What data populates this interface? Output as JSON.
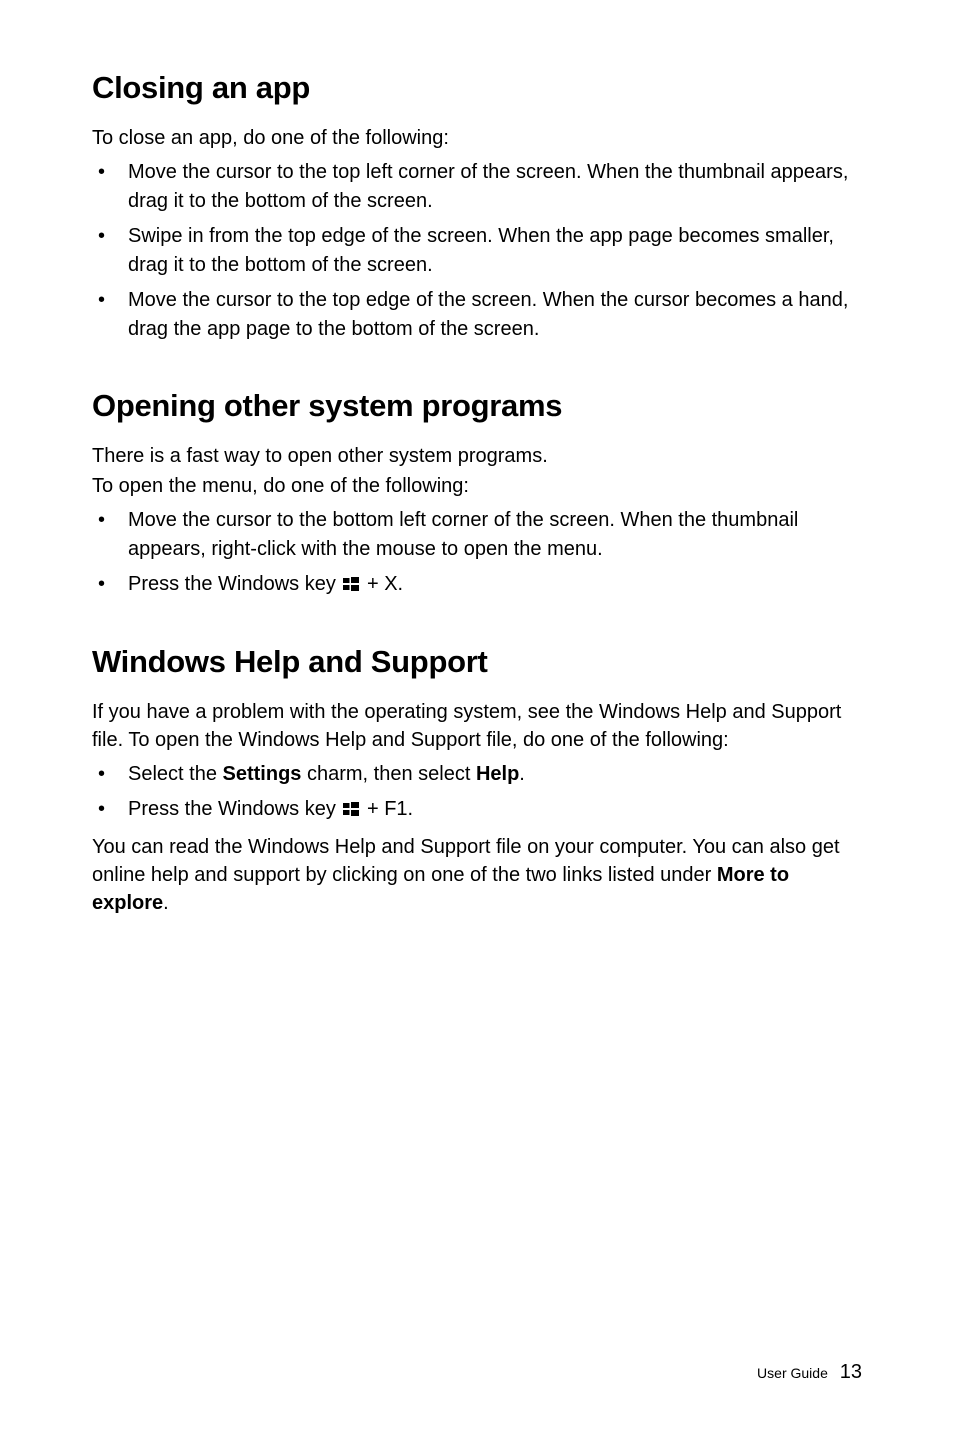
{
  "sections": {
    "closing": {
      "heading": "Closing an app",
      "intro": "To close an app, do one of the following:",
      "bullets": [
        "Move the cursor to the top left corner of the screen. When the thumbnail appears, drag it to the bottom of the screen.",
        "Swipe in from the top edge of the screen. When the app page becomes smaller, drag it to the bottom of the screen.",
        "Move the cursor to the top edge of the screen. When the cursor becomes a hand, drag the app page to the bottom of the screen."
      ]
    },
    "opening": {
      "heading": "Opening other system programs",
      "intro1": "There is a fast way to open other system programs.",
      "intro2": "To open the menu, do one of the following:",
      "bullets": [
        "Move the cursor to the bottom left corner of the screen. When the thumbnail appears, right-click with the mouse to open the menu."
      ],
      "bullet2_pre": "Press the Windows key ",
      "bullet2_post": " + X."
    },
    "help": {
      "heading": "Windows Help and Support",
      "intro": "If you have a problem with the operating system, see the Windows Help and Support file. To open the Windows Help and Support file, do one of the following:",
      "bullet1_pre": "Select the ",
      "bullet1_bold1": "Settings",
      "bullet1_mid": " charm, then select ",
      "bullet1_bold2": "Help",
      "bullet1_post": ".",
      "bullet2_pre": "Press the Windows key ",
      "bullet2_post": " + F1.",
      "after_pre": "You can read the Windows Help and Support file on your computer. You can also get online help and support by clicking on one of the two links listed under ",
      "after_bold": "More to explore",
      "after_post": "."
    }
  },
  "footer": {
    "label": "User Guide",
    "page": "13"
  }
}
